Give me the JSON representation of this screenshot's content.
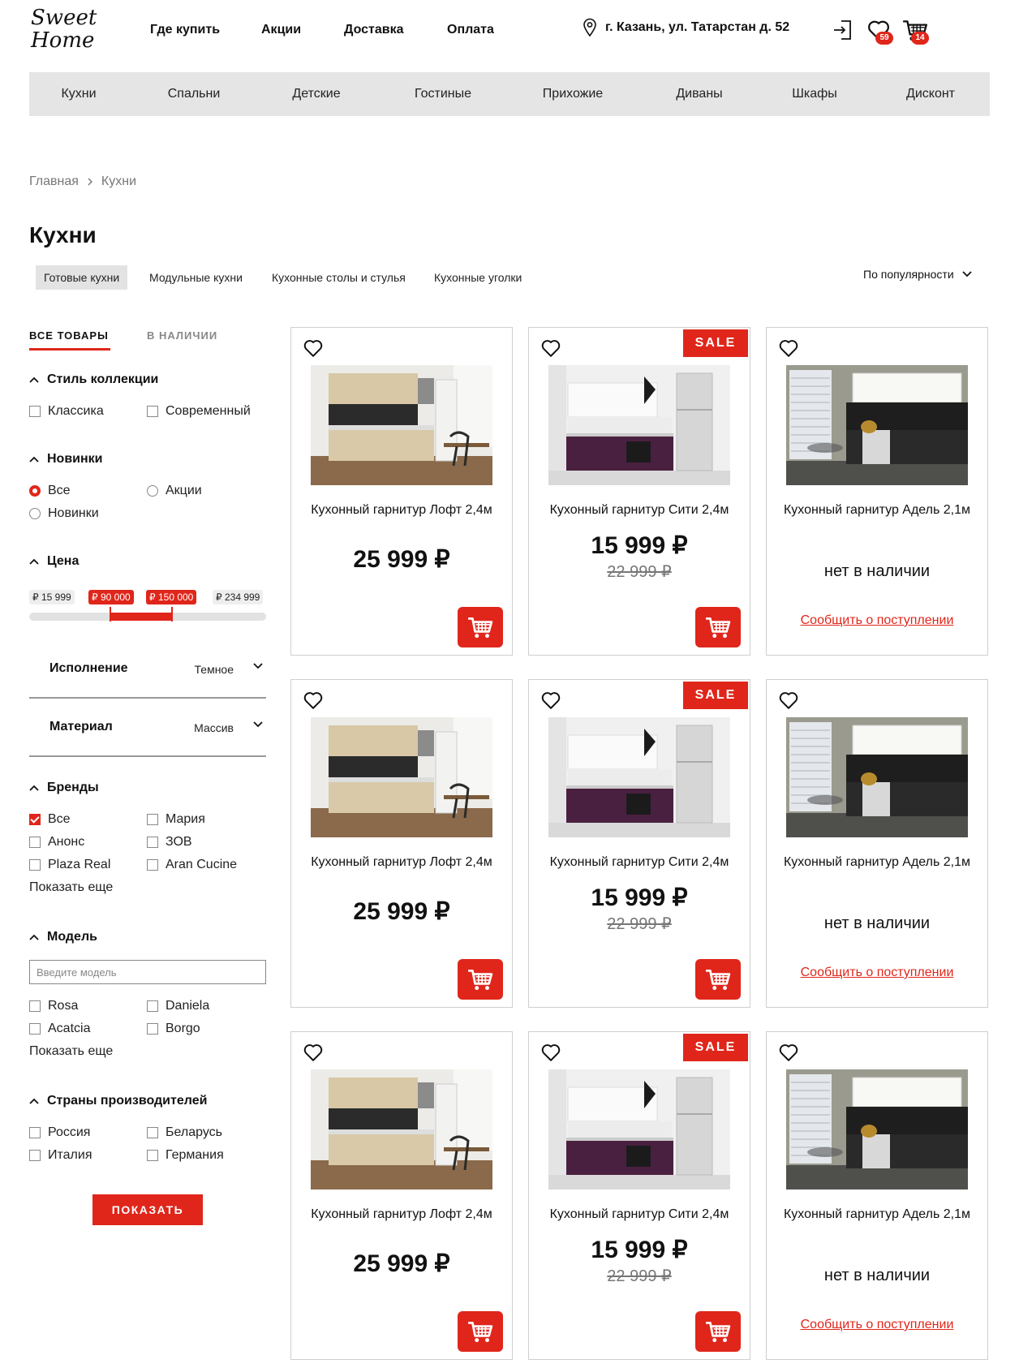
{
  "header": {
    "logo_line1": "Sweet",
    "logo_line2": "Home",
    "nav": [
      "Где купить",
      "Акции",
      "Доставка",
      "Оплата"
    ],
    "address": "г. Казань, ул. Татарстан д. 52",
    "favorites_count": "59",
    "cart_count": "14"
  },
  "categories": [
    "Кухни",
    "Спальни",
    "Детские",
    "Гостиные",
    "Прихожие",
    "Диваны",
    "Шкафы",
    "Дисконт"
  ],
  "breadcrumb": {
    "home": "Главная",
    "current": "Кухни"
  },
  "page_title": "Кухни",
  "subtabs": [
    "Готовые кухни",
    "Модульные кухни",
    "Кухонные столы и стулья",
    "Кухонные уголки"
  ],
  "sort_label": "По популярности",
  "filters": {
    "tab_all": "ВСЕ ТОВАРЫ",
    "tab_instock": "В НАЛИЧИИ",
    "style": {
      "title": "Стиль коллекции",
      "options": [
        "Классика",
        "Современный"
      ]
    },
    "novelty": {
      "title": "Новинки",
      "options": [
        "Все",
        "Акции",
        "Новинки"
      ],
      "selected": "Все"
    },
    "price": {
      "title": "Цена",
      "min": "₽ 15 999",
      "from": "₽ 90 000",
      "to": "₽ 150 000",
      "max": "₽ 234 999"
    },
    "execution": {
      "label": "Исполнение",
      "value": "Темное"
    },
    "material": {
      "label": "Материал",
      "value": "Массив"
    },
    "brands": {
      "title": "Бренды",
      "options": [
        "Все",
        "Мария",
        "Анонс",
        "ЗОВ",
        "Plaza Real",
        "Aran Cucine"
      ],
      "checked": "Все",
      "more": "Показать еще"
    },
    "model": {
      "title": "Модель",
      "placeholder": "Введите модель",
      "options": [
        "Rosa",
        "Daniela",
        "Acatcia",
        "Borgo"
      ],
      "more": "Показать еще"
    },
    "countries": {
      "title": "Страны производителей",
      "options": [
        "Россия",
        "Беларусь",
        "Италия",
        "Германия"
      ]
    },
    "show_button": "ПОКАЗАТЬ"
  },
  "sale_label": "SALE",
  "products": [
    {
      "name": "Кухонный гарнитур Лофт 2,4м",
      "price": "25 999 ₽"
    },
    {
      "name": "Кухонный гарнитур Сити 2,4м",
      "price": "15 999 ₽",
      "old_price": "22 999 ₽",
      "sale": true
    },
    {
      "name": "Кухонный гарнитур Адель 2,1м",
      "status": "нет в наличии",
      "notify": "Сообщить о поступлении"
    },
    {
      "name": "Кухонный гарнитур Лофт 2,4м",
      "price": "25 999 ₽"
    },
    {
      "name": "Кухонный гарнитур Сити 2,4м",
      "price": "15 999 ₽",
      "old_price": "22 999 ₽",
      "sale": true
    },
    {
      "name": "Кухонный гарнитур Адель 2,1м",
      "status": "нет в наличии",
      "notify": "Сообщить о поступлении"
    },
    {
      "name": "Кухонный гарнитур Лофт 2,4м",
      "price": "25 999 ₽"
    },
    {
      "name": "Кухонный гарнитур Сити 2,4м",
      "price": "15 999 ₽",
      "old_price": "22 999 ₽",
      "sale": true
    },
    {
      "name": "Кухонный гарнитур Адель 2,1м",
      "status": "нет в наличии",
      "notify": "Сообщить о поступлении"
    }
  ],
  "colors": {
    "accent": "#e0261b",
    "bar": "#e5e5e5"
  }
}
